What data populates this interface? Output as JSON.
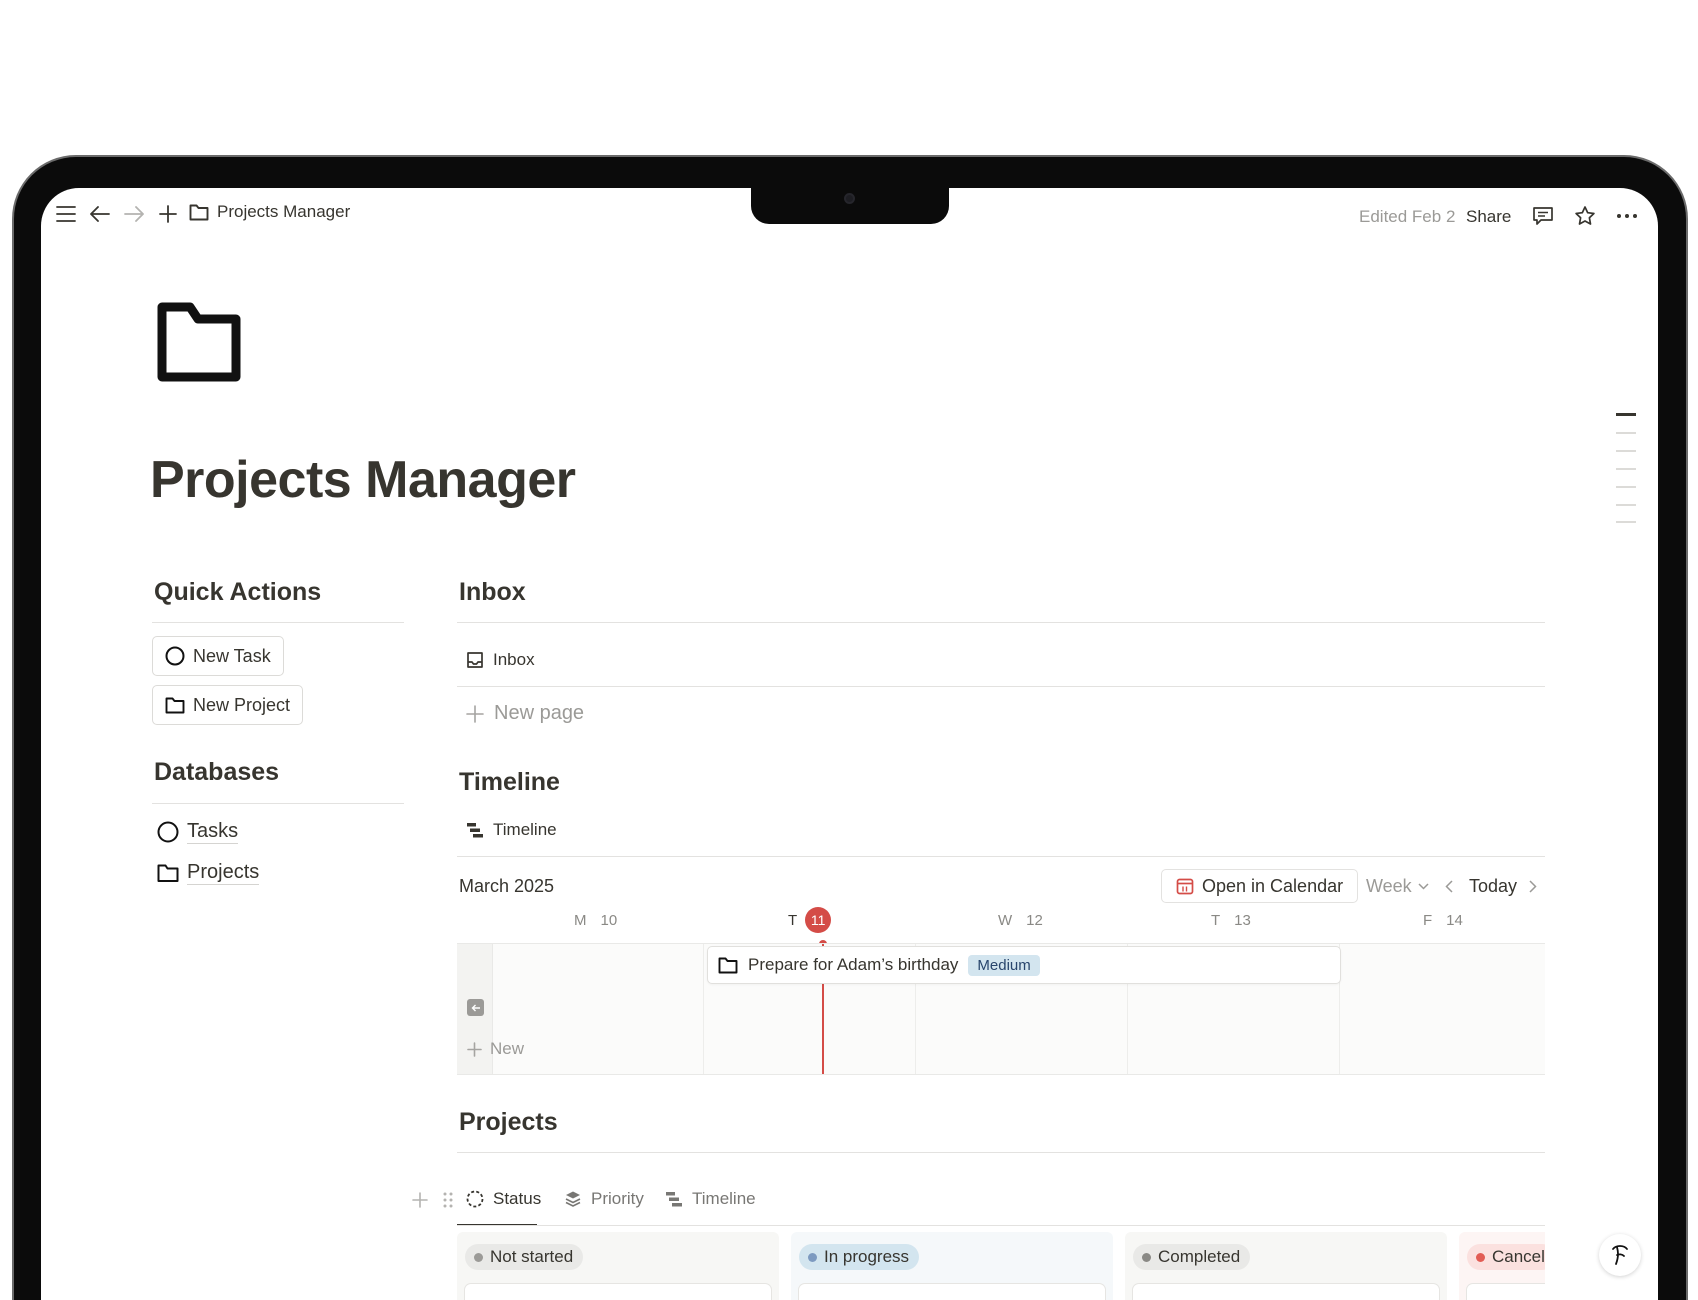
{
  "topbar": {
    "breadcrumb": "Projects Manager",
    "edited": "Edited Feb 2",
    "share": "Share"
  },
  "page": {
    "title": "Projects Manager"
  },
  "quick_actions": {
    "heading": "Quick Actions",
    "new_task": "New Task",
    "new_project": "New Project"
  },
  "databases": {
    "heading": "Databases",
    "items": [
      "Tasks",
      "Projects"
    ]
  },
  "inbox": {
    "heading": "Inbox",
    "view_tab": "Inbox",
    "new_page": "New page"
  },
  "timeline": {
    "heading": "Timeline",
    "view_tab": "Timeline",
    "month": "March 2025",
    "open_calendar": "Open in Calendar",
    "range": "Week",
    "today": "Today",
    "days": [
      {
        "letter": "M",
        "num": "10"
      },
      {
        "letter": "T",
        "num": "11"
      },
      {
        "letter": "W",
        "num": "12"
      },
      {
        "letter": "T",
        "num": "13"
      },
      {
        "letter": "F",
        "num": "14"
      }
    ],
    "event": {
      "title": "Prepare for Adam’s birthday",
      "priority": "Medium"
    },
    "new_label": "New"
  },
  "projects": {
    "heading": "Projects",
    "tabs": [
      "Status",
      "Priority",
      "Timeline"
    ],
    "board": [
      {
        "label": "Not started",
        "color": "#9b9a97",
        "bg": "#f7f7f5",
        "pill": "#e9e9e7"
      },
      {
        "label": "In progress",
        "color": "#7d9ac0",
        "bg": "#f5f8fa",
        "pill": "#d3e5ef"
      },
      {
        "label": "Completed",
        "color": "#8a8985",
        "bg": "#f7f7f5",
        "pill": "#e9e9e7"
      },
      {
        "label": "Cancel",
        "color": "#e25c54",
        "bg": "#fdf5f4",
        "pill": "#fbe1df"
      }
    ]
  },
  "colors": {
    "accent_red": "#d44c47",
    "text": "#37352f",
    "muted": "#9b9a97"
  }
}
